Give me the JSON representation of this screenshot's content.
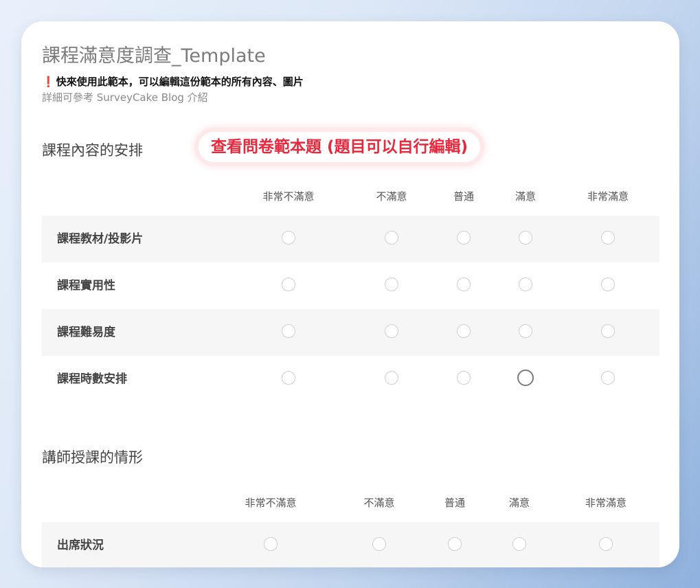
{
  "survey": {
    "title": "課程滿意度調查_Template",
    "notice_mark": "❗",
    "notice": "快來使用此範本，可以編輯這份範本的所有內容、圖片",
    "subnote": "詳細可參考 SurveyCake Blog 介紹"
  },
  "pill_label": "查看問卷範本題 (題目可以自行編輯)",
  "sections": [
    {
      "heading": "課程內容的安排",
      "columns": [
        "非常不滿意",
        "不滿意",
        "普通",
        "滿意",
        "非常滿意"
      ],
      "rows": [
        {
          "label": "課程教材/投影片"
        },
        {
          "label": "課程實用性"
        },
        {
          "label": "課程難易度"
        },
        {
          "label": "課程時數安排"
        }
      ]
    },
    {
      "heading": "講師授課的情形",
      "columns": [
        "非常不滿意",
        "不滿意",
        "普通",
        "滿意",
        "非常滿意"
      ],
      "rows": [
        {
          "label": "出席狀況"
        }
      ]
    }
  ],
  "colors": {
    "pill_text": "#e8283c",
    "row_shade": "#f6f6f6",
    "radio_border": "#cfcfcf"
  }
}
